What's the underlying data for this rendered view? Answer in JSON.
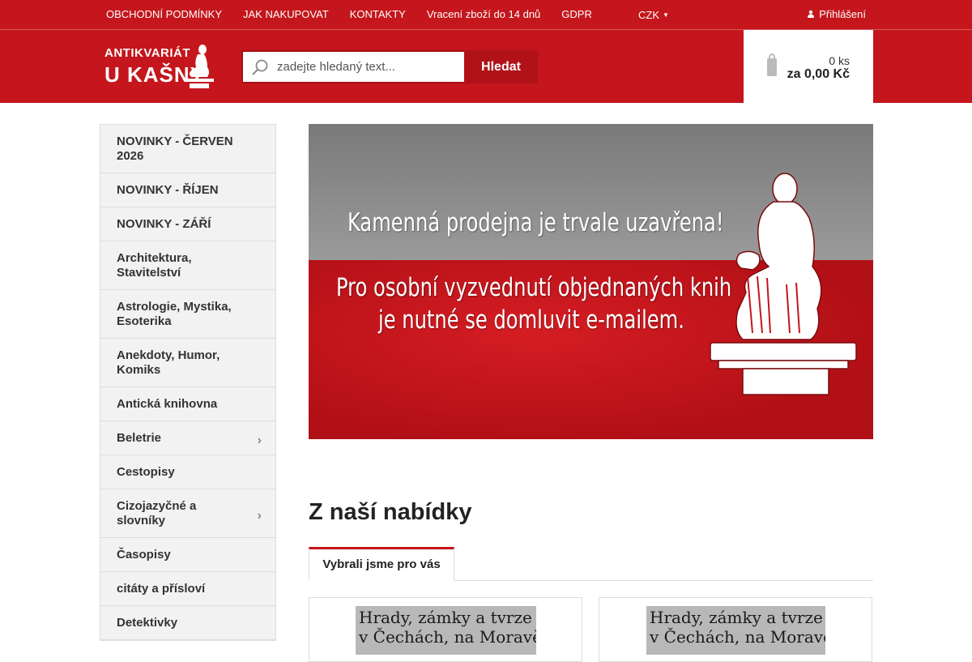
{
  "topbar": {
    "links": [
      "OBCHODNÍ PODMÍNKY",
      "JAK NAKUPOVAT",
      "KONTAKTY",
      "Vracení zboží do 14 dnů",
      "GDPR"
    ],
    "currency": "CZK",
    "login": "Přihlášení"
  },
  "header": {
    "logo_line1": "ANTIKVARIÁT",
    "logo_line2": "U KAŠNY",
    "search_placeholder": "zadejte hledaný text...",
    "search_button": "Hledat",
    "cart_count": "0 ks",
    "cart_total": "za 0,00 Kč"
  },
  "sidebar": {
    "items": [
      {
        "label": "NOVINKY - ČERVEN 2026",
        "has_arrow": false
      },
      {
        "label": "NOVINKY - ŘÍJEN",
        "has_arrow": false
      },
      {
        "label": "NOVINKY - ZÁŘÍ",
        "has_arrow": false
      },
      {
        "label": "Architektura, Stavitelství",
        "has_arrow": false
      },
      {
        "label": "Astrologie, Mystika, Esoterika",
        "has_arrow": false
      },
      {
        "label": "Anekdoty, Humor, Komiks",
        "has_arrow": false
      },
      {
        "label": "Antická knihovna",
        "has_arrow": false
      },
      {
        "label": "Beletrie",
        "has_arrow": true
      },
      {
        "label": "Cestopisy",
        "has_arrow": false
      },
      {
        "label": "Cizojazyčné a slovníky",
        "has_arrow": true
      },
      {
        "label": "Časopisy",
        "has_arrow": false
      },
      {
        "label": "citáty a přísloví",
        "has_arrow": false
      },
      {
        "label": "Detektivky",
        "has_arrow": false
      }
    ]
  },
  "banner": {
    "line1": "Kamenná prodejna je trvale uzavřena!",
    "line2": "Pro osobní vyzvednutí objednaných knih",
    "line3": "je nutné se domluvit e-mailem."
  },
  "offer": {
    "title": "Z naší nabídky",
    "tab_active": "Vybrali jsme pro vás",
    "products": [
      {
        "cover_line1": "Hrady, zámky a tvrze",
        "cover_line2": "v Čechách, na Moravě"
      },
      {
        "cover_line1": "Hrady, zámky a tvrze",
        "cover_line2": "v Čechách, na Moravě"
      }
    ]
  },
  "colors": {
    "brand_red": "#c4161c",
    "dark_red": "#b01218",
    "sidebar_bg": "#f2f2f2"
  },
  "icons": [
    "search-icon",
    "cart-icon",
    "user-icon",
    "chevron-right-icon",
    "caret-down-icon"
  ]
}
